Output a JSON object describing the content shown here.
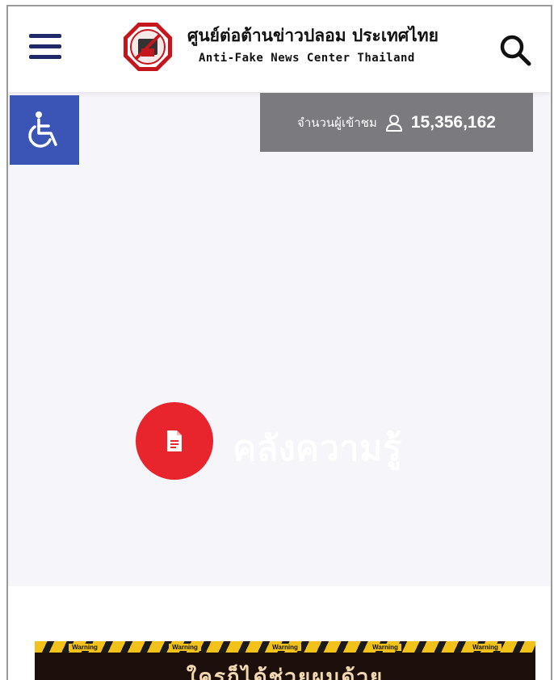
{
  "header": {
    "title_thai": "ศูนย์ต่อต้านข่าวปลอม ประเทศไทย",
    "title_en": "Anti-Fake News Center Thailand",
    "menu_icon": "hamburger-menu-icon",
    "search_icon": "search-icon",
    "logo": "anti-fake-news-logo"
  },
  "accessibility": {
    "icon": "wheelchair-icon"
  },
  "visitor_counter": {
    "label": "จำนวนผู้เข้าชม",
    "icon": "user-icon",
    "count": "15,356,162"
  },
  "knowledge_section": {
    "icon": "document-icon",
    "title": "คลังความรู้"
  },
  "banner": {
    "warning_label": "Warning",
    "warning_labels": [
      "Warning",
      "Warning",
      "Warning",
      "Warning",
      "Warning"
    ],
    "caption": "ใครก็ได้ช่วยผมด้วย"
  },
  "colors": {
    "navy": "#1f2a6b",
    "accessibility_blue": "#3a55b6",
    "counter_gray": "#7b7b7f",
    "accent_red": "#e8242d",
    "content_bg": "#f6f5f9",
    "warning_yellow": "#f2c21a"
  }
}
